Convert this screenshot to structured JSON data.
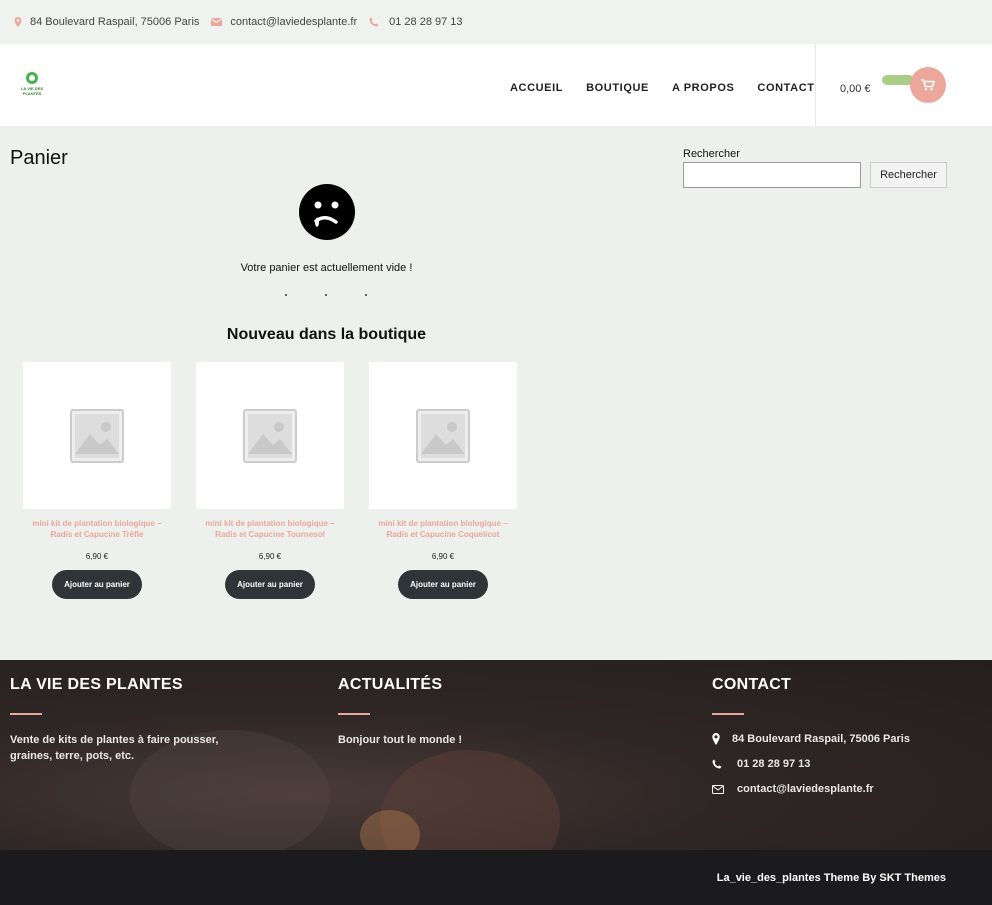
{
  "topbar": {
    "address": "84 Boulevard Raspail, 75006 Paris",
    "email": "contact@laviedesplante.fr",
    "phone": "01 28 28 97 13",
    "icon_color": "#eba79b"
  },
  "header": {
    "logo_text": "LA VIE DES PLANTES",
    "nav": [
      "ACCUEIL",
      "BOUTIQUE",
      "A PROPOS",
      "CONTACT"
    ],
    "cart_total": "0,00 €",
    "cart_icon": "shopping-cart-icon"
  },
  "main": {
    "title": "Panier",
    "empty_icon": "sad-face-icon",
    "empty_message": "Votre panier est actuellement vide !",
    "new_title": "Nouveau dans la boutique",
    "products": [
      {
        "name": "mini kit de plantation biologique – Radis et Capucine Trèfle",
        "price": "6,90 €",
        "button": "Ajouter au panier"
      },
      {
        "name": "mini kit de plantation biologique – Radis et Capucine Tournesol",
        "price": "6,90 €",
        "button": "Ajouter au panier"
      },
      {
        "name": "mini kit de plantation biologique – Radis et Capucine Coquelicot",
        "price": "6,90 €",
        "button": "Ajouter au panier"
      }
    ]
  },
  "sidebar": {
    "search_label": "Rechercher",
    "search_value": "",
    "search_button": "Rechercher"
  },
  "footer": {
    "col1_title": "LA VIE DES PLANTES",
    "col1_text": "Vente de kits de plantes à faire pousser, graines, terre, pots, etc.",
    "col2_title": "ACTUALITÉS",
    "col2_link": "Bonjour tout le monde !",
    "col3_title": "CONTACT",
    "address": "84 Boulevard Raspail, 75006 Paris",
    "phone": "01 28 28 97 13",
    "email": "contact@laviedesplante.fr",
    "credit": "La_vie_des_plantes Theme By SKT Themes",
    "accent": "#eba79b"
  }
}
